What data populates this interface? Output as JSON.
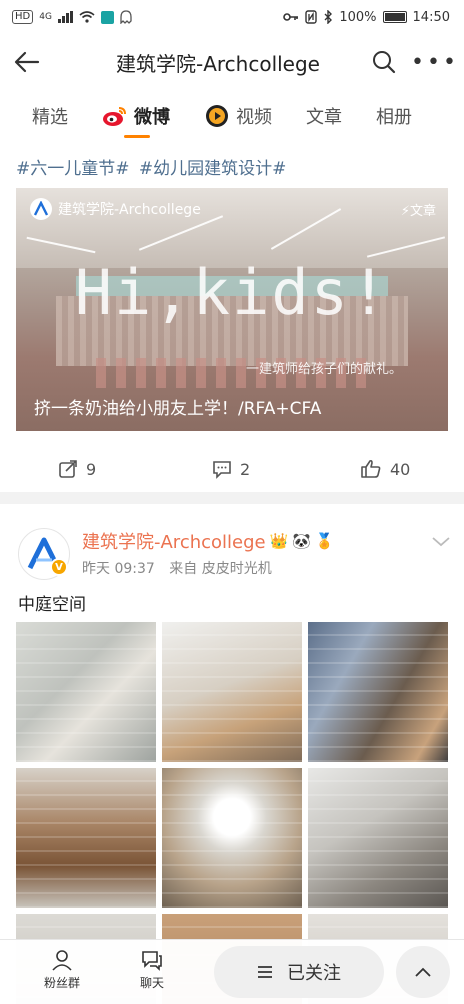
{
  "status_bar": {
    "network_chip": "HD",
    "signal_label": "4G",
    "battery": "100%",
    "time": "14:50"
  },
  "nav": {
    "title": "建筑学院-Archcollege"
  },
  "tabs": [
    {
      "label": "精选"
    },
    {
      "label": "微博"
    },
    {
      "label": "视频"
    },
    {
      "label": "文章"
    },
    {
      "label": "相册"
    }
  ],
  "post1": {
    "hashtags": [
      "#六一儿童节#",
      "#幼儿园建筑设计#"
    ],
    "article": {
      "source": "建筑学院-Archcollege",
      "badge": "文章",
      "headline_big": "Hi,kids!",
      "subline": "一建筑师给孩子们的献礼。",
      "caption": "挤一条奶油给小朋友上学！/RFA+CFA"
    },
    "actions": {
      "repost_count": "9",
      "comment_count": "2",
      "like_count": "40"
    }
  },
  "post2": {
    "author": "建筑学院-Archcollege",
    "time": "昨天 09:37",
    "source": "来自 皮皮时光机",
    "text": "中庭空间",
    "photo_count_shown": 9
  },
  "bottom_bar": {
    "fans_label": "粉丝群",
    "chat_label": "聊天",
    "follow_label": "已关注"
  },
  "colors": {
    "accent": "#ff8200",
    "author": "#eb7350",
    "hashtag": "#4f6f8f",
    "verified": "#f7a600"
  }
}
